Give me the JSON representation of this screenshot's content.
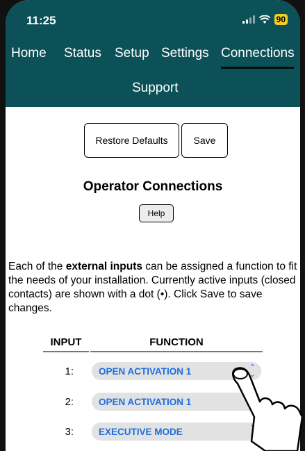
{
  "status_bar": {
    "time": "11:25",
    "battery": "90"
  },
  "nav": {
    "items": [
      "Home",
      "Status",
      "Setup",
      "Settings",
      "Connections",
      "Support"
    ],
    "active": "Connections"
  },
  "buttons": {
    "restore": "Restore Defaults",
    "save": "Save",
    "help": "Help"
  },
  "page_title": "Operator Connections",
  "description": {
    "part1": "Each of the ",
    "bold": "external inputs",
    "part2": " can be assigned a function to fit the needs of your installation. Currently active inputs (closed contacts) are shown with a dot (•). Click Save to save changes."
  },
  "table": {
    "headers": {
      "input": "INPUT",
      "function": "FUNCTION"
    },
    "rows": [
      {
        "input": "1:",
        "function": "OPEN ACTIVATION 1"
      },
      {
        "input": "2:",
        "function": "OPEN ACTIVATION 1"
      },
      {
        "input": "3:",
        "function": "EXECUTIVE MODE"
      }
    ]
  },
  "colors": {
    "header": "#0b5157",
    "accent": "#1e6ee0",
    "battery": "#f2d020"
  },
  "icons": [
    "wifi-icon",
    "signal-icon",
    "battery-icon",
    "select-arrows-icon",
    "hand-pointer-icon"
  ]
}
